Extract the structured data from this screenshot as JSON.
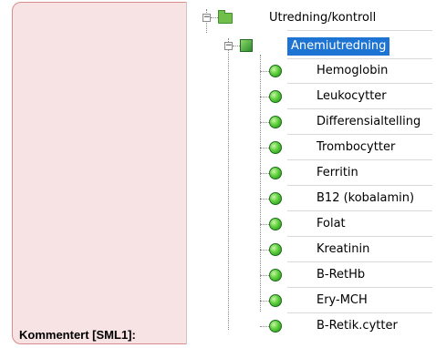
{
  "comment": {
    "label": "Kommentert [SML1]:"
  },
  "tree": {
    "root": {
      "label": "Utredning/kontroll",
      "icon": "folder-icon",
      "expander": "−"
    },
    "group": {
      "label": "Anemiutredning",
      "icon": "group-icon",
      "expander": "−",
      "selected": true
    },
    "items": [
      {
        "label": "Hemoglobin",
        "icon": "green-ball-icon"
      },
      {
        "label": "Leukocytter",
        "icon": "green-ball-icon"
      },
      {
        "label": "Differensialtelling",
        "icon": "green-ball-icon"
      },
      {
        "label": "Trombocytter",
        "icon": "green-ball-icon"
      },
      {
        "label": "Ferritin",
        "icon": "green-ball-icon"
      },
      {
        "label": "B12 (kobalamin)",
        "icon": "green-ball-icon"
      },
      {
        "label": "Folat",
        "icon": "green-ball-icon"
      },
      {
        "label": "Kreatinin",
        "icon": "green-ball-icon"
      },
      {
        "label": "B-RetHb",
        "icon": "green-ball-icon"
      },
      {
        "label": "Ery-MCH",
        "icon": "green-ball-icon"
      },
      {
        "label": "B-Retik.cytter",
        "icon": "green-ball-icon"
      }
    ],
    "colors": {
      "selection": "#1e74d3",
      "icon_green": "#5fcf3c"
    }
  }
}
